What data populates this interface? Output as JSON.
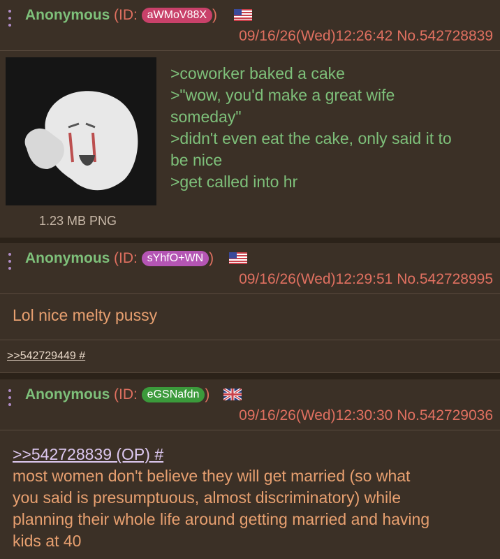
{
  "posts": [
    {
      "name": "Anonymous",
      "id_label": "(ID: ",
      "id": "aWMoV88X",
      "id_close": ")",
      "id_color": "#c9416a",
      "flag": "us-flag-icon",
      "datetime": "09/16/26(Wed)12:26:42",
      "number": "No.542728839",
      "file_info": "1.23 MB PNG",
      "lines": [
        ">coworker baked a cake",
        ">\"wow, you'd make a great wife",
        "someday\"",
        ">didn't even eat the cake, only said it to",
        "be nice",
        ">get called into hr"
      ]
    },
    {
      "name": "Anonymous",
      "id_label": "(ID: ",
      "id": "sYhfO+WN",
      "id_close": ")",
      "id_color": "#b455b4",
      "flag": "us-flag-icon",
      "datetime": "09/16/26(Wed)12:29:51",
      "number": "No.542728995",
      "text": "Lol nice melty pussy",
      "replies": ">>542729449 #"
    },
    {
      "name": "Anonymous",
      "id_label": "(ID: ",
      "id": "eGSNafdn",
      "id_close": ")",
      "id_color": "#3b9a3b",
      "flag": "uk-flag-icon",
      "datetime": "09/16/26(Wed)12:30:30",
      "number": "No.542729036",
      "quote": ">>542728839 (OP) #",
      "lines": [
        "most women don't believe they will get married (so what",
        "you said is presumptuous, almost discriminatory) while",
        "planning their whole life around getting married and having",
        "kids at 40"
      ]
    }
  ]
}
